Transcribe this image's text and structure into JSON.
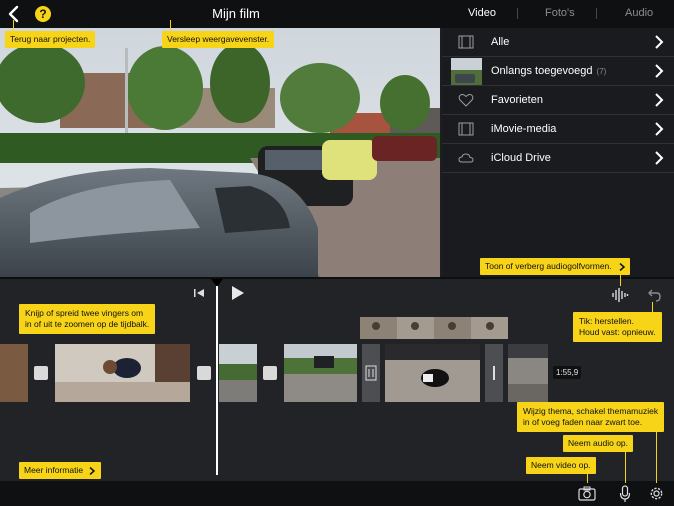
{
  "header": {
    "title": "Mijn film",
    "tabs": [
      {
        "label": "Video",
        "active": true
      },
      {
        "label": "Foto's",
        "active": false
      },
      {
        "label": "Audio",
        "active": false
      }
    ],
    "help_glyph": "?"
  },
  "browser": {
    "items": [
      {
        "label": "Alle",
        "icon": "film-strip-icon"
      },
      {
        "label": "Onlangs toegevoegd",
        "count": "(7)",
        "icon": "thumbnail"
      },
      {
        "label": "Favorieten",
        "icon": "heart-icon"
      },
      {
        "label": "iMovie-media",
        "icon": "film-strip-icon"
      },
      {
        "label": "iCloud Drive",
        "icon": "cloud-icon"
      }
    ]
  },
  "timeline": {
    "duration_badge": "1:55,9"
  },
  "tips": {
    "back": "Terug naar projecten.",
    "drag": "Versleep weergavevenster.",
    "waveforms": "Toon of verberg audiogolfvormen.",
    "pinch_1": "Knijp of spreid twee vingers om",
    "pinch_2": "in of uit te zoomen op de tijdbalk.",
    "undo_1": "Tik: herstellen.",
    "undo_2": "Houd vast: opnieuw.",
    "more_info": "Meer informatie",
    "theme_1": "Wijzig thema, schakel themamuziek",
    "theme_2": "in of voeg faden naar zwart toe.",
    "audio": "Neem audio op.",
    "video": "Neem video op."
  },
  "colors": {
    "accent_yellow": "#f7d418",
    "background": "#1c1e21",
    "bar": "#0f1012"
  }
}
